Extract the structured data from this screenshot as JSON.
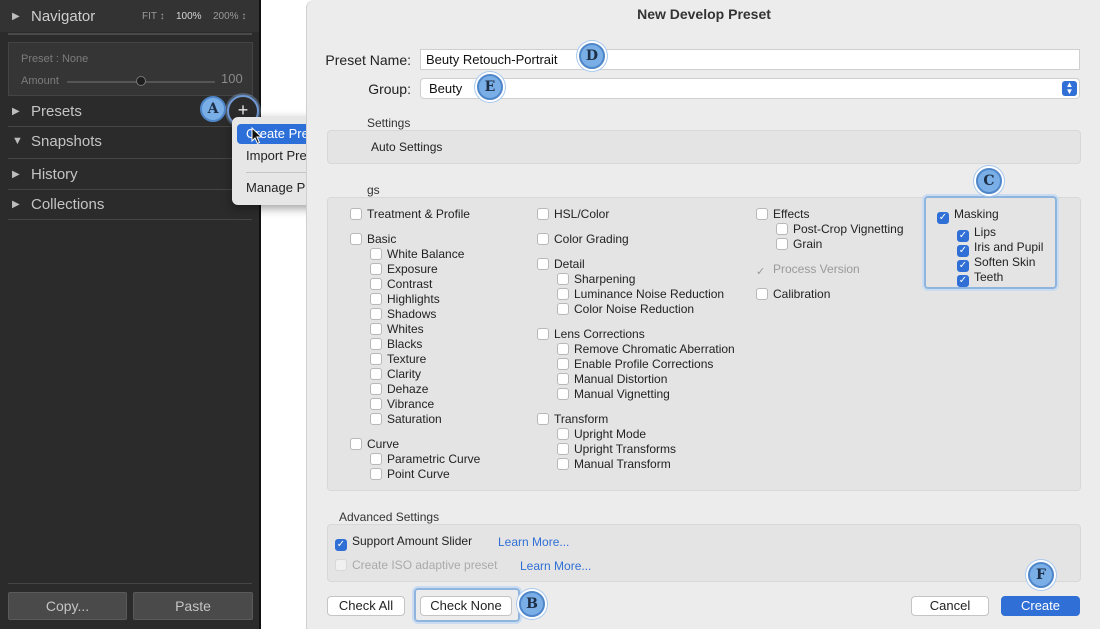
{
  "left_panel": {
    "navigator": {
      "title": "Navigator",
      "fit": "FIT ↕",
      "zoom_100": "100%",
      "zoom_200": "200% ↕"
    },
    "preset_box": {
      "preset_label": "Preset : None",
      "amount_label": "Amount",
      "amount_value": "100"
    },
    "sections": {
      "presets": "Presets",
      "snapshots": "Snapshots",
      "history": "History",
      "collections": "Collections"
    },
    "plus": "+",
    "copy_label": "Copy...",
    "paste_label": "Paste"
  },
  "context_menu": {
    "items": [
      "Create Preset...",
      "Import Presets...",
      "Manage Presets..."
    ]
  },
  "callouts": {
    "a": "A",
    "b": "B",
    "c": "C",
    "d": "D",
    "e": "E",
    "f": "F"
  },
  "dialog": {
    "title": "New Develop Preset",
    "preset_name_label": "Preset Name:",
    "preset_name_value": "Beuty Retouch-Portrait",
    "group_label": "Group:",
    "group_value": "Beuty",
    "auto_section_label": "Settings",
    "auto_settings": "Auto Settings",
    "settings_section_label": "gs",
    "col1": {
      "treatment": "Treatment & Profile",
      "basic": "Basic",
      "basic_items": [
        "White Balance",
        "Exposure",
        "Contrast",
        "Highlights",
        "Shadows",
        "Whites",
        "Blacks",
        "Texture",
        "Clarity",
        "Dehaze",
        "Vibrance",
        "Saturation"
      ],
      "curve": "Curve",
      "curve_items": [
        "Parametric Curve",
        "Point Curve"
      ]
    },
    "col2": {
      "hsl": "HSL/Color",
      "grading": "Color Grading",
      "detail": "Detail",
      "detail_items": [
        "Sharpening",
        "Luminance Noise Reduction",
        "Color Noise Reduction"
      ],
      "lens": "Lens Corrections",
      "lens_items": [
        "Remove Chromatic Aberration",
        "Enable Profile Corrections",
        "Manual Distortion",
        "Manual Vignetting"
      ],
      "transform": "Transform",
      "transform_items": [
        "Upright Mode",
        "Upright Transforms",
        "Manual Transform"
      ]
    },
    "col3": {
      "effects": "Effects",
      "effects_items": [
        "Post-Crop Vignetting",
        "Grain"
      ],
      "process_version": "Process Version",
      "calibration": "Calibration"
    },
    "masking": {
      "label": "Masking",
      "items": [
        "Lips",
        "Iris and Pupil",
        "Soften Skin",
        "Teeth"
      ]
    },
    "advanced": {
      "label": "Advanced Settings",
      "support_amount": "Support Amount Slider",
      "iso_adaptive": "Create ISO adaptive preset",
      "learn_more": "Learn More..."
    },
    "buttons": {
      "check_all": "Check All",
      "check_none": "Check None",
      "cancel": "Cancel",
      "create": "Create"
    }
  }
}
